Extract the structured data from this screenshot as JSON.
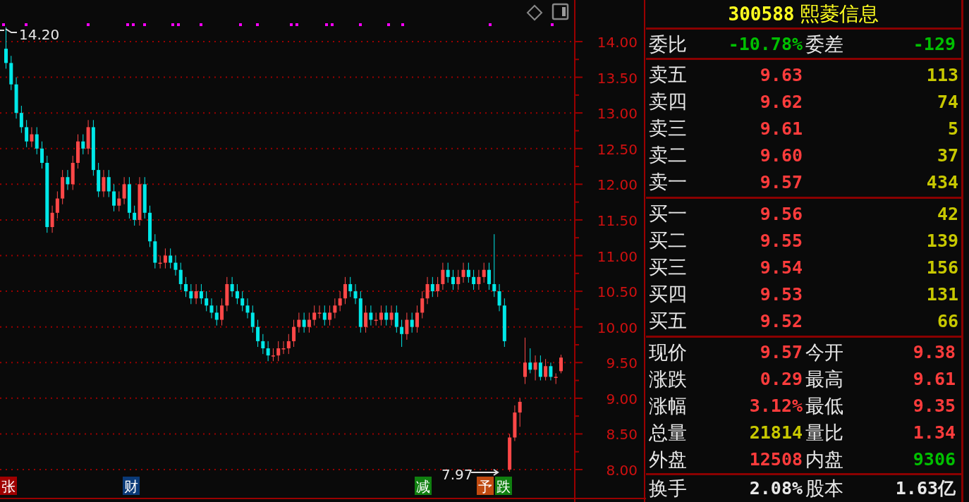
{
  "chart": {
    "high_label": "14.20",
    "low_label": "7.97",
    "chart_data": {
      "type": "candlestick",
      "grid": true,
      "ylim": [
        7.595,
        14.583
      ],
      "categories": [
        null,
        null,
        null,
        null,
        null,
        null,
        null,
        null,
        null,
        null,
        null,
        null,
        null,
        null,
        null,
        null,
        null,
        null,
        null,
        null,
        null,
        null,
        null,
        null,
        null,
        null,
        null,
        null,
        null,
        null,
        null,
        null,
        null,
        null,
        null,
        null,
        null,
        null,
        null,
        null,
        null,
        null,
        null,
        null,
        null,
        null,
        null,
        null,
        null,
        null,
        null,
        null,
        null,
        null,
        null,
        null,
        null,
        null,
        null,
        null,
        null,
        null,
        null,
        null,
        null,
        null,
        null,
        null,
        null,
        null,
        null,
        null,
        null,
        null,
        null,
        null,
        null,
        null,
        null,
        null,
        null,
        null,
        null,
        null,
        null,
        null,
        null,
        null,
        null,
        null,
        null,
        null,
        null,
        null,
        null,
        null,
        null,
        null,
        null,
        null,
        null,
        null,
        null,
        null,
        null,
        null,
        null,
        null,
        null
      ],
      "yticks": [
        {
          "value": 14,
          "label": "14.00"
        },
        {
          "value": 13.5,
          "label": "13.50"
        },
        {
          "value": 13,
          "label": "13.00"
        },
        {
          "value": 12.5,
          "label": "12.50"
        },
        {
          "value": 12,
          "label": "12.00"
        },
        {
          "value": 11.5,
          "label": "11.50"
        },
        {
          "value": 11,
          "label": "11.00"
        },
        {
          "value": 10.5,
          "label": "10.50"
        },
        {
          "value": 10,
          "label": "10.00"
        },
        {
          "value": 9.5,
          "label": "9.50"
        },
        {
          "value": 9,
          "label": "9.00"
        },
        {
          "value": 8.5,
          "label": "8.50"
        },
        {
          "value": 8,
          "label": "8.00"
        }
      ],
      "ohlc": [
        [
          13.9,
          14.2,
          13.62,
          13.7
        ],
        [
          13.7,
          13.8,
          13.32,
          13.4
        ],
        [
          13.4,
          13.5,
          12.92,
          13.0
        ],
        [
          13.0,
          13.1,
          12.72,
          12.8
        ],
        [
          12.8,
          12.9,
          12.52,
          12.6
        ],
        [
          12.6,
          12.8,
          12.52,
          12.7
        ],
        [
          12.7,
          12.8,
          12.42,
          12.5
        ],
        [
          12.5,
          12.6,
          12.22,
          12.3
        ],
        [
          12.3,
          12.4,
          11.32,
          11.4
        ],
        [
          11.4,
          11.7,
          11.32,
          11.6
        ],
        [
          11.6,
          11.9,
          11.52,
          11.8
        ],
        [
          11.8,
          12.2,
          11.72,
          12.1
        ],
        [
          12.1,
          12.2,
          11.92,
          12.0
        ],
        [
          12.0,
          12.4,
          11.92,
          12.3
        ],
        [
          12.3,
          12.7,
          12.22,
          12.6
        ],
        [
          12.6,
          12.7,
          12.42,
          12.5
        ],
        [
          12.5,
          12.9,
          12.42,
          12.8
        ],
        [
          12.8,
          12.9,
          12.12,
          12.2
        ],
        [
          12.2,
          12.3,
          11.82,
          11.9
        ],
        [
          11.9,
          12.2,
          11.82,
          12.1
        ],
        [
          12.1,
          12.2,
          11.82,
          11.9
        ],
        [
          11.9,
          12.0,
          11.62,
          11.7
        ],
        [
          11.7,
          11.9,
          11.62,
          11.8
        ],
        [
          11.8,
          12.1,
          11.72,
          12.0
        ],
        [
          12.0,
          12.1,
          11.52,
          11.6
        ],
        [
          11.6,
          11.7,
          11.42,
          11.5
        ],
        [
          11.5,
          12.1,
          11.42,
          12.0
        ],
        [
          12.0,
          12.1,
          11.52,
          11.6
        ],
        [
          11.6,
          11.7,
          11.12,
          11.2
        ],
        [
          11.2,
          11.3,
          10.82,
          10.9
        ],
        [
          10.9,
          11.0,
          10.82,
          10.9
        ],
        [
          10.9,
          11.1,
          10.82,
          11.0
        ],
        [
          11.0,
          11.1,
          10.82,
          10.9
        ],
        [
          10.9,
          11.0,
          10.72,
          10.8
        ],
        [
          10.8,
          10.9,
          10.52,
          10.6
        ],
        [
          10.6,
          10.7,
          10.42,
          10.5
        ],
        [
          10.5,
          10.6,
          10.32,
          10.4
        ],
        [
          10.4,
          10.6,
          10.32,
          10.5
        ],
        [
          10.5,
          10.6,
          10.32,
          10.4
        ],
        [
          10.4,
          10.5,
          10.22,
          10.3
        ],
        [
          10.3,
          10.4,
          10.12,
          10.2
        ],
        [
          10.2,
          10.3,
          10.02,
          10.1
        ],
        [
          10.1,
          10.4,
          10.02,
          10.3
        ],
        [
          10.3,
          10.7,
          10.22,
          10.6
        ],
        [
          10.6,
          10.7,
          10.42,
          10.5
        ],
        [
          10.5,
          10.6,
          10.32,
          10.4
        ],
        [
          10.4,
          10.5,
          10.22,
          10.3
        ],
        [
          10.3,
          10.4,
          10.12,
          10.2
        ],
        [
          10.2,
          10.3,
          9.92,
          10.0
        ],
        [
          10.0,
          10.1,
          9.72,
          9.8
        ],
        [
          9.8,
          9.9,
          9.62,
          9.7
        ],
        [
          9.7,
          9.8,
          9.52,
          9.6
        ],
        [
          9.6,
          9.7,
          9.52,
          9.6
        ],
        [
          9.6,
          9.8,
          9.52,
          9.7
        ],
        [
          9.7,
          9.8,
          9.62,
          9.7
        ],
        [
          9.7,
          9.9,
          9.62,
          9.8
        ],
        [
          9.8,
          10.1,
          9.72,
          10.0
        ],
        [
          10.0,
          10.2,
          9.92,
          10.1
        ],
        [
          10.1,
          10.2,
          9.92,
          10.0
        ],
        [
          10.0,
          10.2,
          9.92,
          10.1
        ],
        [
          10.1,
          10.3,
          10.02,
          10.2
        ],
        [
          10.2,
          10.3,
          10.12,
          10.2
        ],
        [
          10.2,
          10.3,
          10.02,
          10.1
        ],
        [
          10.1,
          10.3,
          10.02,
          10.2
        ],
        [
          10.2,
          10.4,
          10.12,
          10.3
        ],
        [
          10.3,
          10.5,
          10.22,
          10.4
        ],
        [
          10.4,
          10.7,
          10.32,
          10.6
        ],
        [
          10.6,
          10.7,
          10.42,
          10.5
        ],
        [
          10.5,
          10.6,
          10.32,
          10.4
        ],
        [
          10.4,
          10.5,
          9.92,
          10.0
        ],
        [
          10.0,
          10.3,
          9.92,
          10.2
        ],
        [
          10.2,
          10.3,
          10.02,
          10.1
        ],
        [
          10.1,
          10.2,
          10.02,
          10.1
        ],
        [
          10.1,
          10.3,
          10.02,
          10.2
        ],
        [
          10.2,
          10.3,
          10.02,
          10.1
        ],
        [
          10.1,
          10.3,
          10.02,
          10.2
        ],
        [
          10.2,
          10.3,
          9.92,
          10.0
        ],
        [
          10.0,
          10.1,
          9.72,
          9.9
        ],
        [
          9.9,
          10.2,
          9.82,
          10.1
        ],
        [
          10.1,
          10.2,
          9.92,
          10.0
        ],
        [
          10.0,
          10.3,
          9.92,
          10.2
        ],
        [
          10.2,
          10.5,
          10.12,
          10.4
        ],
        [
          10.4,
          10.7,
          10.32,
          10.6
        ],
        [
          10.6,
          10.7,
          10.42,
          10.5
        ],
        [
          10.5,
          10.7,
          10.42,
          10.6
        ],
        [
          10.6,
          10.9,
          10.52,
          10.8
        ],
        [
          10.8,
          10.9,
          10.62,
          10.7
        ],
        [
          10.7,
          10.8,
          10.52,
          10.6
        ],
        [
          10.6,
          10.8,
          10.52,
          10.7
        ],
        [
          10.7,
          10.9,
          10.62,
          10.8
        ],
        [
          10.8,
          10.9,
          10.62,
          10.7
        ],
        [
          10.7,
          10.8,
          10.52,
          10.6
        ],
        [
          10.6,
          10.8,
          10.52,
          10.7
        ],
        [
          10.7,
          10.9,
          10.62,
          10.8
        ],
        [
          10.8,
          10.9,
          10.52,
          10.6
        ],
        [
          10.6,
          11.3,
          10.42,
          10.5
        ],
        [
          10.5,
          10.6,
          10.22,
          10.3
        ],
        [
          10.3,
          10.4,
          9.72,
          9.8
        ],
        [
          8.0,
          8.5,
          7.97,
          8.45
        ],
        [
          8.45,
          8.9,
          8.4,
          8.8
        ],
        [
          8.8,
          9.0,
          8.6,
          8.95
        ],
        [
          9.3,
          9.85,
          9.2,
          9.5
        ],
        [
          9.5,
          9.7,
          9.35,
          9.4
        ],
        [
          9.4,
          9.6,
          9.25,
          9.5
        ],
        [
          9.5,
          9.6,
          9.25,
          9.3
        ],
        [
          9.3,
          9.55,
          9.25,
          9.45
        ],
        [
          9.45,
          9.5,
          9.25,
          9.3
        ],
        [
          9.3,
          9.35,
          9.2,
          9.3
        ],
        [
          9.38,
          9.61,
          9.35,
          9.57
        ]
      ]
    },
    "events": [
      {
        "text": "张",
        "color": "#a00000"
      },
      {
        "text": "财",
        "color": "#0a3a78"
      },
      {
        "text": "减",
        "color": "#108010"
      },
      {
        "text": "予",
        "color": "#c04a10"
      },
      {
        "text": "跌",
        "color": "#108010"
      }
    ]
  },
  "quote": {
    "code": "300588",
    "name": "熙菱信息",
    "ratio": [
      {
        "label": "委比",
        "value": "-10.78%",
        "color": "#00c000"
      },
      {
        "label": "委差",
        "value": "-129",
        "color": "#00c000"
      }
    ],
    "asks": [
      {
        "label": "卖五",
        "price": "9.63",
        "volume": "113"
      },
      {
        "label": "卖四",
        "price": "9.62",
        "volume": "74"
      },
      {
        "label": "卖三",
        "price": "9.61",
        "volume": "5"
      },
      {
        "label": "卖二",
        "price": "9.60",
        "volume": "37"
      },
      {
        "label": "卖一",
        "price": "9.57",
        "volume": "434"
      }
    ],
    "bids": [
      {
        "label": "买一",
        "price": "9.56",
        "volume": "42"
      },
      {
        "label": "买二",
        "price": "9.55",
        "volume": "139"
      },
      {
        "label": "买三",
        "price": "9.54",
        "volume": "156"
      },
      {
        "label": "买四",
        "price": "9.53",
        "volume": "131"
      },
      {
        "label": "买五",
        "price": "9.52",
        "volume": "66"
      }
    ],
    "stats": [
      {
        "label": "现价",
        "value": "9.57",
        "color": "#ff3c3c"
      },
      {
        "label": "今开",
        "value": "9.38",
        "color": "#ff3c3c"
      },
      {
        "label": "涨跌",
        "value": "0.29",
        "color": "#ff3c3c"
      },
      {
        "label": "最高",
        "value": "9.61",
        "color": "#ff3c3c"
      },
      {
        "label": "涨幅",
        "value": "3.12%",
        "color": "#ff3c3c"
      },
      {
        "label": "最低",
        "value": "9.35",
        "color": "#ff3c3c"
      },
      {
        "label": "总量",
        "value": "21814",
        "color": "#c8c800"
      },
      {
        "label": "量比",
        "value": "1.34",
        "color": "#ff3c3c"
      },
      {
        "label": "外盘",
        "value": "12508",
        "color": "#ff3c3c"
      },
      {
        "label": "内盘",
        "value": "9306",
        "color": "#00c000"
      }
    ],
    "footer": [
      {
        "label": "换手",
        "value": "2.08%",
        "color": "#e8e8e8"
      },
      {
        "label": "股本",
        "value": "1.63亿",
        "color": "#e8e8e8"
      }
    ]
  }
}
